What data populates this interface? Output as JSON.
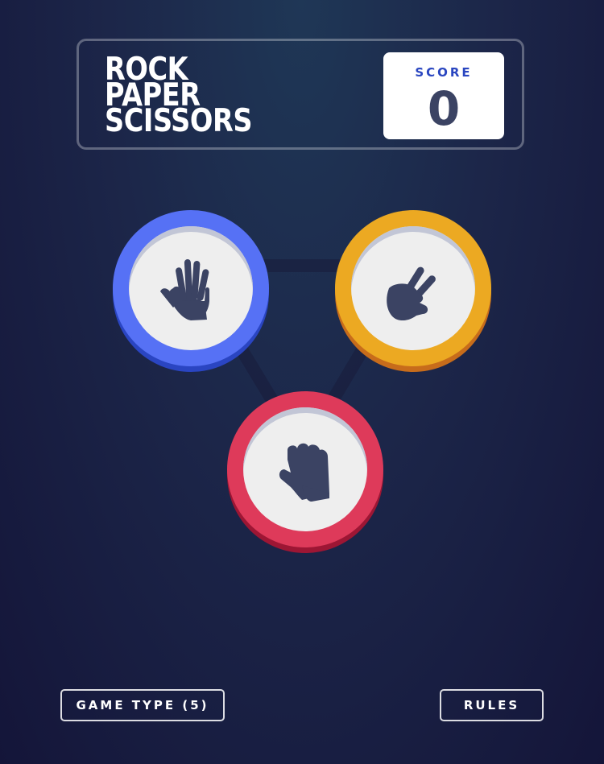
{
  "header": {
    "title_lines": [
      "ROCK",
      "PAPER",
      "SCISSORS"
    ],
    "score_label": "SCORE",
    "score_value": "0"
  },
  "tokens": [
    {
      "name": "paper",
      "ring_color": "#5671f5",
      "icon": "paper-hand-icon"
    },
    {
      "name": "scissors",
      "ring_color": "#eca922",
      "icon": "scissors-hand-icon"
    },
    {
      "name": "rock",
      "ring_color": "#de3a5a",
      "icon": "rock-fist-icon"
    }
  ],
  "footer": {
    "game_type_label": "GAME TYPE (5)",
    "rules_label": "RULES"
  },
  "colors": {
    "background_top": "#1f3756",
    "background_bottom": "#141539",
    "score_label": "#2a46c0",
    "score_value": "#3b4363",
    "icon_fill": "#3b4363"
  }
}
